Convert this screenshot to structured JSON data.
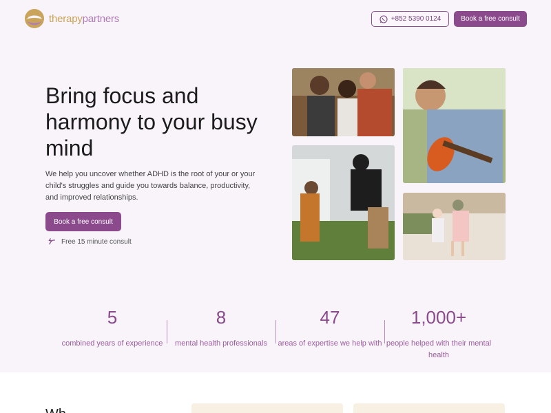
{
  "brand": {
    "part1": "therapy",
    "part2": "partners",
    "color_gold": "#c9a45a",
    "color_purple": "#8a4a8c"
  },
  "header": {
    "phone": "+852 5390 0124",
    "phone_icon": "whatsapp-icon",
    "cta": "Book a free consult"
  },
  "hero": {
    "title": "Bring focus and harmony to your busy mind",
    "description": "We help you uncover whether ADHD is the root of your or your child's struggles and guide you towards balance, productivity, and improved relationships.",
    "cta": "Book a free consult",
    "note": "Free 15 minute consult",
    "note_icon": "curved-arrow-icon"
  },
  "stats": [
    {
      "number": "5",
      "label": "combined years of experience"
    },
    {
      "number": "8",
      "label": "mental health professionals"
    },
    {
      "number": "47",
      "label": "areas of expertise we help with"
    },
    {
      "number": "1,000+",
      "label": "people helped with their mental health"
    }
  ],
  "lower": {
    "heading_partial": "Wh..."
  }
}
